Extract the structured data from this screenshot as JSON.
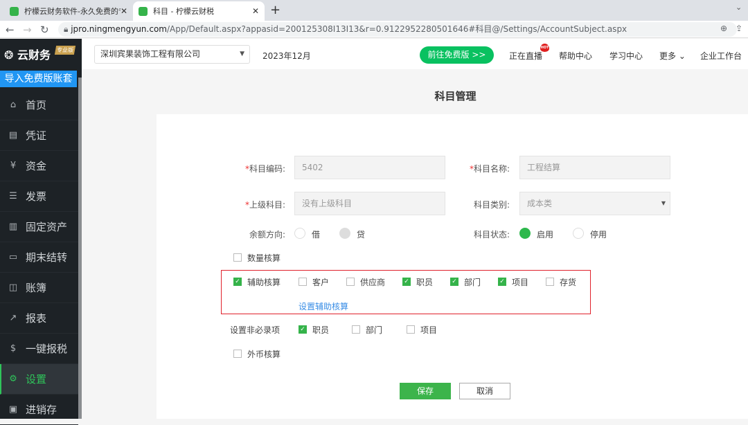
{
  "browser": {
    "tabs": [
      {
        "title": "柠檬云财务软件-永久免费的专业",
        "active": false
      },
      {
        "title": "科目 - 柠檬云财税",
        "active": true
      }
    ],
    "url_host": "jpro.ningmengyun.com",
    "url_path": "/App/Default.aspx?appasid=200125308I13I13&r=0.912295228050164​6#科目@/Settings/AccountSubject.aspx"
  },
  "app": {
    "logo": "云财务",
    "edition_badge": "专业版",
    "import_button": "导入免费版账套",
    "company": "深圳宾果装饰工程有限公司",
    "period": "2023年12月",
    "free_button": "前往免费版 >>",
    "header_links": [
      "正在直播",
      "帮助中心",
      "学习中心",
      "更多",
      "企业工作台"
    ],
    "hot_badge": "HOT",
    "accent": "#09c160"
  },
  "sidebar": {
    "items": [
      {
        "label": "首页",
        "icon": "home-icon"
      },
      {
        "label": "凭证",
        "icon": "voucher-icon"
      },
      {
        "label": "资金",
        "icon": "funds-icon"
      },
      {
        "label": "发票",
        "icon": "invoice-icon"
      },
      {
        "label": "固定资产",
        "icon": "building-icon"
      },
      {
        "label": "期末结转",
        "icon": "calendar-icon"
      },
      {
        "label": "账簿",
        "icon": "book-icon"
      },
      {
        "label": "报表",
        "icon": "chart-icon"
      },
      {
        "label": "一键报税",
        "icon": "dollar-icon"
      },
      {
        "label": "设置",
        "icon": "gear-icon",
        "active": true
      },
      {
        "label": "进销存",
        "icon": "inventory-icon"
      }
    ]
  },
  "form": {
    "title": "科目管理",
    "code_label": "科目编码:",
    "code_value": "5402",
    "name_label": "科目名称:",
    "name_value": "工程结算",
    "parent_label": "上级科目:",
    "parent_placeholder": "没有上级科目",
    "category_label": "科目类别:",
    "category_value": "成本类",
    "direction_label": "余额方向:",
    "direction_options": [
      "借",
      "贷"
    ],
    "direction_selected": "贷",
    "status_label": "科目状态:",
    "status_options": [
      "启用",
      "停用"
    ],
    "status_selected": "启用",
    "quantity": {
      "label": "数量核算",
      "checked": false
    },
    "aux": {
      "label": "辅助核算",
      "checked": true,
      "options": [
        {
          "label": "客户",
          "checked": false
        },
        {
          "label": "供应商",
          "checked": false
        },
        {
          "label": "职员",
          "checked": true
        },
        {
          "label": "部门",
          "checked": true
        },
        {
          "label": "项目",
          "checked": true
        },
        {
          "label": "存货",
          "checked": false
        }
      ]
    },
    "aux_link": "设置辅助核算",
    "optional_label": "设置非必录项",
    "optional": [
      {
        "label": "职员",
        "checked": true
      },
      {
        "label": "部门",
        "checked": false
      },
      {
        "label": "项目",
        "checked": false
      }
    ],
    "foreign": {
      "label": "外币核算",
      "checked": false
    },
    "save": "保存",
    "cancel": "取消"
  }
}
